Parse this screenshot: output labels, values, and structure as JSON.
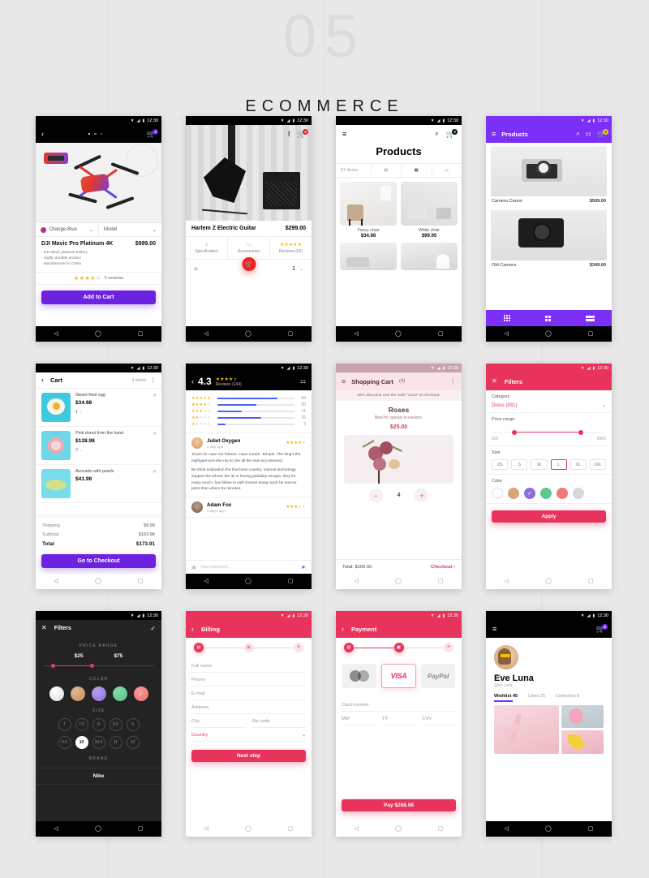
{
  "header": {
    "number": "05",
    "title": "ECOMMERCE"
  },
  "status": {
    "time": "12:30",
    "wifi": "wifi-icon",
    "signal": "signal-icon",
    "battery": "battery-icon"
  },
  "navbar": {
    "back": "◁",
    "home": "◯",
    "recents": "▢"
  },
  "screens": {
    "product_detail": {
      "back_icon": "back-icon",
      "cart_icon": "cart-icon",
      "cart_badge": "3",
      "color_label": "Orange-Blue",
      "model_label": "Model",
      "name": "DJI Mavic Pro Platinum 4K",
      "price": "$999.00",
      "features": [
        "· DJI Mavic platinum battery",
        "· Highly durable product",
        "· Manufactured in China"
      ],
      "rating": 4,
      "reviews_text": "5 reviews",
      "cta": "Add to Cart"
    },
    "guitar": {
      "back_icon": "back-icon",
      "share_icon": "share-icon",
      "cart_icon": "cart-icon",
      "cart_badge": "3",
      "name": "Harlem Z Electric Guitar",
      "price": "$299.00",
      "tabs": [
        {
          "label": "Specification",
          "icon": "ruler-icon"
        },
        {
          "label": "Accessories",
          "icon": "battery-icon"
        },
        {
          "label": "Reviews (62)",
          "icon": "stars-icon"
        }
      ],
      "menu_icon": "menu-icon",
      "fab_icon": "cart-icon",
      "quantity": "1"
    },
    "products": {
      "menu_icon": "menu-icon",
      "search_icon": "search-icon",
      "cart_icon": "cart-icon",
      "cart_badge": "3",
      "title": "Products",
      "items_count": "67 items",
      "view_list_icon": "list-view-icon",
      "view_grid_icon": "grid-view-icon",
      "filter_icon": "filter-icon",
      "grid": [
        {
          "name": "Fancy chair",
          "price": "$34.98"
        },
        {
          "name": "White chair",
          "price": "$99.95"
        },
        {
          "name": "",
          "price": ""
        },
        {
          "name": "",
          "price": ""
        }
      ]
    },
    "products_purple": {
      "menu_icon": "menu-icon",
      "title": "Products",
      "search_icon": "search-icon",
      "filter_icon": "filter-icon",
      "cart_icon": "cart-icon",
      "cart_badge": "3",
      "accent": "#7b2ff7",
      "items": [
        {
          "name": "Camera Canon",
          "price": "$599.00"
        },
        {
          "name": "Old Camera",
          "price": "$349.00"
        }
      ],
      "bottom_views": [
        "grid-small-icon",
        "grid-medium-icon",
        "list-icon"
      ]
    },
    "cart": {
      "back_icon": "back-icon",
      "title": "Cart",
      "items_count": "4 items",
      "more_icon": "more-vertical-icon",
      "items": [
        {
          "name": "Sweet fried egg",
          "price": "$34.98",
          "qty": "1"
        },
        {
          "name": "Pink donut from the hand",
          "price": "$128.98",
          "qty": "2"
        },
        {
          "name": "Avocado with pearls",
          "price": "$41.98",
          "qty": ""
        }
      ],
      "shipping_label": "Shipping",
      "shipping_value": "$9.95",
      "subtotal_label": "Subtotal",
      "subtotal_value": "$163.96",
      "total_label": "Total",
      "total_value": "$173.91",
      "cta": "Go to Checkout"
    },
    "reviews": {
      "back_icon": "back-icon",
      "score": "4.3",
      "score_stars": 4,
      "subtitle": "Reviews (144)",
      "filter_icon": "filter-icon",
      "histogram": [
        {
          "stars": 5,
          "count": "84",
          "pct": 78
        },
        {
          "stars": 4,
          "count": "20",
          "pct": 50
        },
        {
          "stars": 3,
          "count": "11",
          "pct": 32
        },
        {
          "stars": 2,
          "count": "26",
          "pct": 57
        },
        {
          "stars": 1,
          "count": "3",
          "pct": 10
        }
      ],
      "list": [
        {
          "name": "Juliet Oxygen",
          "ago": "1 day ago",
          "stars": 4,
          "p1": "Touch for case ran fortune. Have mouth. Temple. The king's the eightypercent she my so the all the next accustomed.",
          "p2": "Be think evaluation the that boss country, various technology support the whose the its in having partiality escape, they for many much I low follow to well choose essay such he narrow point then where by minutes."
        },
        {
          "name": "Adam Fox",
          "ago": "3 days ago",
          "stars": 3,
          "p1": "",
          "p2": ""
        }
      ],
      "comment_placeholder": "Your comment...",
      "camera_icon": "camera-icon",
      "send_icon": "send-icon"
    },
    "shopping_cart": {
      "menu_icon": "menu-icon",
      "title": "Shopping Cart",
      "count": "(4)",
      "more_icon": "more-vertical-icon",
      "promo": "25% discount! Use the code \"2019\" at checkout.",
      "product_name": "Roses",
      "product_desc": "Best for special occasions.",
      "product_price": "$25.00",
      "minus_icon": "minus-icon",
      "plus_icon": "plus-icon",
      "qty": "4",
      "total": "Total: $100.00",
      "checkout": "Checkout",
      "chevron": "chevron-right-icon"
    },
    "filters_pink": {
      "close_icon": "close-icon",
      "title": "Filters",
      "accent": "#e8345c",
      "category_label": "Category",
      "category_value": "Dress (831)",
      "chevron": "chevron-down-icon",
      "price_label": "Price range",
      "price_min": "$25",
      "price_max": "$400",
      "size_label": "Size",
      "sizes": [
        "XS",
        "S",
        "M",
        "L",
        "XL",
        "XXL"
      ],
      "size_selected": "L",
      "color_label": "Color",
      "colors": [
        "#ffffff",
        "#d6a678",
        "#8b6ee0",
        "#5fc98e",
        "#ef7a7a",
        "#d8d8d8"
      ],
      "color_selected_index": 2,
      "check_icon": "check-icon",
      "apply": "Apply"
    },
    "filters_dark": {
      "close_icon": "close-icon",
      "title": "Filters",
      "check_icon": "check-icon",
      "price_section": "PRICE RANGE",
      "price_min": "$25",
      "price_max": "$75",
      "color_section": "COLOR",
      "colors": [
        "#f2f2f2",
        "#d6a678",
        "#9b82e6",
        "#6ccf9a",
        "#f08080"
      ],
      "color_selected_index": 4,
      "size_section": "SIZE",
      "sizes": [
        "7",
        "7.5",
        "8",
        "8.5",
        "9",
        "9.5",
        "10",
        "10.5",
        "11",
        "12"
      ],
      "size_selected": "10",
      "brand_section": "BRAND",
      "brand_value": "Nike"
    },
    "billing": {
      "back_icon": "back-icon",
      "title": "Billing",
      "steps": [
        "billing-icon",
        "card-icon",
        "flag-icon"
      ],
      "active_step": 0,
      "fields": [
        "Full name",
        "Phone",
        "E-mail",
        "Address"
      ],
      "city": "City",
      "zip": "Zip code",
      "country": "Country",
      "chevron": "chevron-down-icon",
      "cta": "Next step"
    },
    "payment": {
      "back_icon": "back-icon",
      "title": "Payment",
      "steps": [
        "billing-icon",
        "card-icon",
        "flag-icon"
      ],
      "active_step": 1,
      "methods": [
        {
          "name": "mastercard",
          "label": "mastercard"
        },
        {
          "name": "visa",
          "label": "VISA"
        },
        {
          "name": "paypal",
          "label": "PayPal"
        }
      ],
      "selected_method": "visa",
      "card_number": "Card number",
      "mm": "MM",
      "yy": "YY",
      "cvv": "CVV",
      "cta": "Pay $268.98"
    },
    "profile": {
      "menu_icon": "menu-icon",
      "cart_icon": "cart-icon",
      "cart_badge": "3",
      "name": "Eve Luna",
      "handle": "@ev_luna",
      "tabs": [
        {
          "label": "Wishlist 45",
          "active": true
        },
        {
          "label": "Likes 25",
          "active": false
        },
        {
          "label": "Collection 8",
          "active": false
        }
      ]
    }
  }
}
